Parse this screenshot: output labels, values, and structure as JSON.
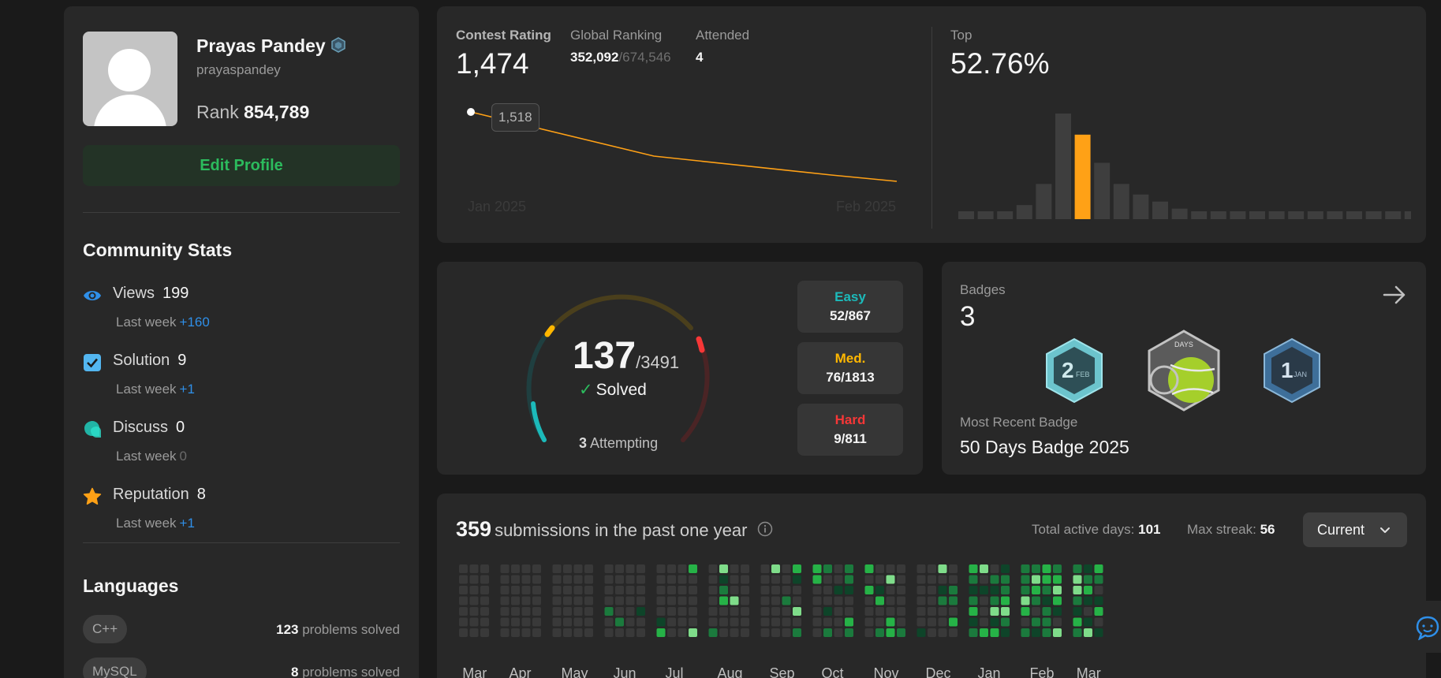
{
  "profile": {
    "name": "Prayas Pandey",
    "username": "prayaspandey",
    "rank_label": "Rank",
    "rank_value": "854,789",
    "edit_label": "Edit Profile"
  },
  "community": {
    "title": "Community Stats",
    "items": [
      {
        "label": "Views",
        "value": "199",
        "sub": "Last week",
        "delta": "+160",
        "icon": "eye-icon",
        "color": "#2f8fe8"
      },
      {
        "label": "Solution",
        "value": "9",
        "sub": "Last week",
        "delta": "+1",
        "icon": "checkbox-icon",
        "color": "#53b6f0"
      },
      {
        "label": "Discuss",
        "value": "0",
        "sub": "Last week",
        "delta": "0",
        "icon": "discuss-icon",
        "color": "#21b4a6"
      },
      {
        "label": "Reputation",
        "value": "8",
        "sub": "Last week",
        "delta": "+1",
        "icon": "star-icon",
        "color": "#ffa116"
      }
    ]
  },
  "languages": {
    "title": "Languages",
    "items": [
      {
        "name": "C++",
        "count": "123",
        "suffix": "problems solved"
      },
      {
        "name": "MySQL",
        "count": "8",
        "suffix": "problems solved"
      }
    ]
  },
  "contest": {
    "rating_label": "Contest Rating",
    "rating": "1,474",
    "global_label": "Global Ranking",
    "global_rank": "352,092",
    "global_total": "/674,546",
    "attended_label": "Attended",
    "attended": "4",
    "top_label": "Top",
    "top_value": "52.76%",
    "tooltip": "1,518",
    "x_start": "Jan 2025",
    "x_end": "Feb 2025"
  },
  "chart_data": [
    {
      "type": "line",
      "x": [
        "Jan 2025",
        "",
        "",
        "Feb 2025"
      ],
      "values": [
        1518,
        1490,
        1478,
        1474
      ],
      "highlight_point": 1518,
      "color": "#ffa116"
    },
    {
      "type": "bar",
      "values": [
        1,
        1,
        1,
        2,
        5,
        15,
        12,
        8,
        5,
        3.5,
        2.5,
        1.5,
        1,
        1,
        1,
        1,
        1,
        1,
        1,
        1,
        1,
        1,
        1,
        1
      ],
      "highlight_index": 6,
      "highlight_color": "#ffa116",
      "color": "#3e3e3e"
    }
  ],
  "progress": {
    "solved": "137",
    "total": "/3491",
    "solved_label": "Solved",
    "attempting_count": "3",
    "attempting_label": "Attempting",
    "difficulties": [
      {
        "name": "Easy",
        "value": "52/867",
        "color": "#1cbaba"
      },
      {
        "name": "Med.",
        "value": "76/1813",
        "color": "#ffb700"
      },
      {
        "name": "Hard",
        "value": "9/811",
        "color": "#f63737"
      }
    ]
  },
  "badges": {
    "label": "Badges",
    "count": "3",
    "recent_label": "Most Recent Badge",
    "recent_value": "50 Days Badge 2025",
    "items": [
      {
        "num": "2",
        "sub": "FEB"
      },
      {
        "top": "DAYS"
      },
      {
        "num": "1",
        "sub": "JAN"
      }
    ]
  },
  "submissions": {
    "count": "359",
    "title": "submissions in the past one year",
    "active_label": "Total active days:",
    "active_value": "101",
    "streak_label": "Max streak:",
    "streak_value": "56",
    "dropdown": "Current",
    "months": [
      "Mar",
      "Apr",
      "May",
      "Jun",
      "Jul",
      "Aug",
      "Sep",
      "Oct",
      "Nov",
      "Dec",
      "Jan",
      "Feb",
      "Mar"
    ]
  }
}
